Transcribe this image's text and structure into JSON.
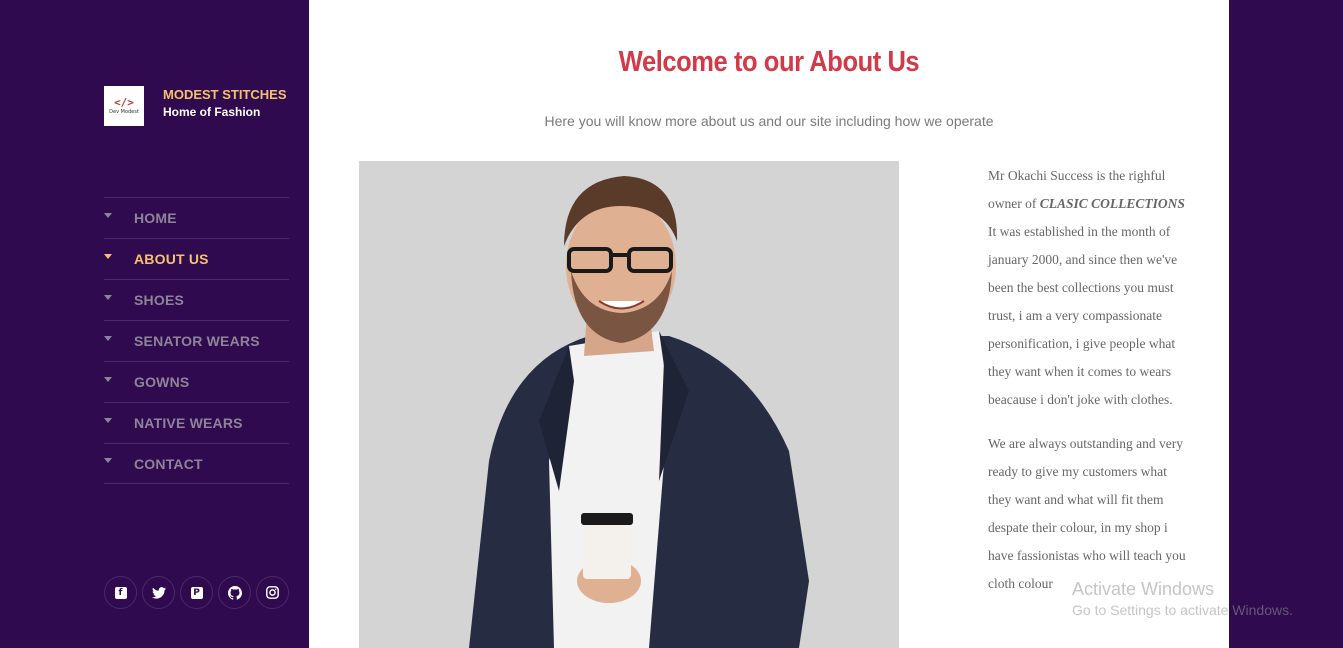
{
  "brand": {
    "name": "MODEST STITCHES",
    "tagline": "Home of Fashion",
    "logo_glyph": "</>",
    "logo_text": "Dev Modest"
  },
  "nav": {
    "items": [
      {
        "label": "HOME",
        "active": false
      },
      {
        "label": "ABOUT US",
        "active": true
      },
      {
        "label": "SHOES",
        "active": false
      },
      {
        "label": "SENATOR WEARS",
        "active": false
      },
      {
        "label": "GOWNS",
        "active": false
      },
      {
        "label": "NATIVE WEARS",
        "active": false
      },
      {
        "label": "CONTACT",
        "active": false
      }
    ]
  },
  "social": [
    {
      "icon": "facebook-icon",
      "glyph": "f"
    },
    {
      "icon": "twitter-icon",
      "glyph": "🐦"
    },
    {
      "icon": "pinterest-icon",
      "glyph": "P"
    },
    {
      "icon": "github-icon",
      "glyph": "⌘"
    },
    {
      "icon": "instagram-icon",
      "glyph": "◎"
    }
  ],
  "main": {
    "title": "Welcome to our About Us",
    "subtitle": "Here you will know more about us and our site including how we operate",
    "paragraph1_start": "Mr Okachi Success is the righful owner of ",
    "paragraph1_emph": "CLASIC COLLECTIONS",
    "paragraph1_end": " It was established in the month of january 2000, and since then we've been the best collections you must trust, i am a very compassionate personification, i give people what they want when it comes to wears beacause i don't joke with clothes.",
    "paragraph2": "We are always outstanding and very ready to give my customers what they want and what will fit them despate their colour, in my shop i have fassionistas who will teach you cloth colour"
  },
  "watermark": {
    "line1": "Activate Windows",
    "line2": "Go to Settings to activate Windows."
  },
  "colors": {
    "sidebar_bg": "#2f0a4e",
    "accent": "#f5c26b",
    "title": "#d33a48"
  }
}
